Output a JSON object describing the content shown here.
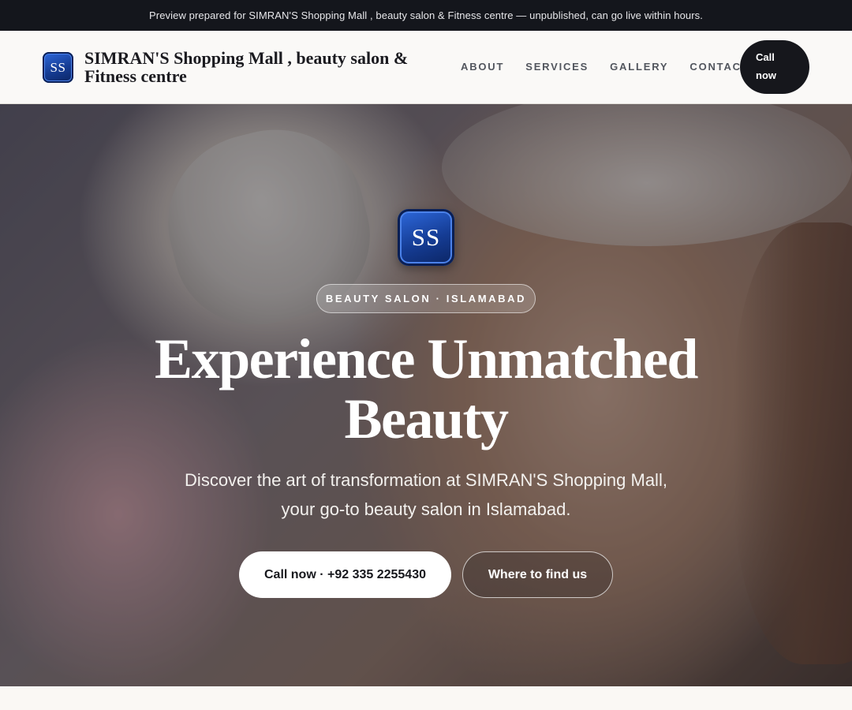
{
  "topbar": {
    "notice": "Preview prepared for SIMRAN'S Shopping Mall , beauty salon & Fitness centre — unpublished, can go live within hours."
  },
  "header": {
    "logo_text": "SS",
    "brand_name": "SIMRAN'S Shopping Mall , beauty salon & Fitness centre",
    "nav": [
      "ABOUT",
      "SERVICES",
      "GALLERY",
      "CONTACT"
    ],
    "cta_line1": "Call",
    "cta_line2": "now"
  },
  "hero": {
    "logo_text": "SS",
    "badge": "BEAUTY SALON · ISLAMABAD",
    "headline_line1": "Experience Unmatched",
    "headline_line2": "Beauty",
    "subtext_line1": "Discover the art of transformation at SIMRAN'S Shopping Mall,",
    "subtext_line2": "your go-to beauty salon in Islamabad.",
    "primary_button": "Call now · +92 335 2255430",
    "secondary_button": "Where to find us"
  },
  "colors": {
    "topbar_bg": "#14161c",
    "cta_bg": "#16171c",
    "logo_blue": "#153c94"
  }
}
